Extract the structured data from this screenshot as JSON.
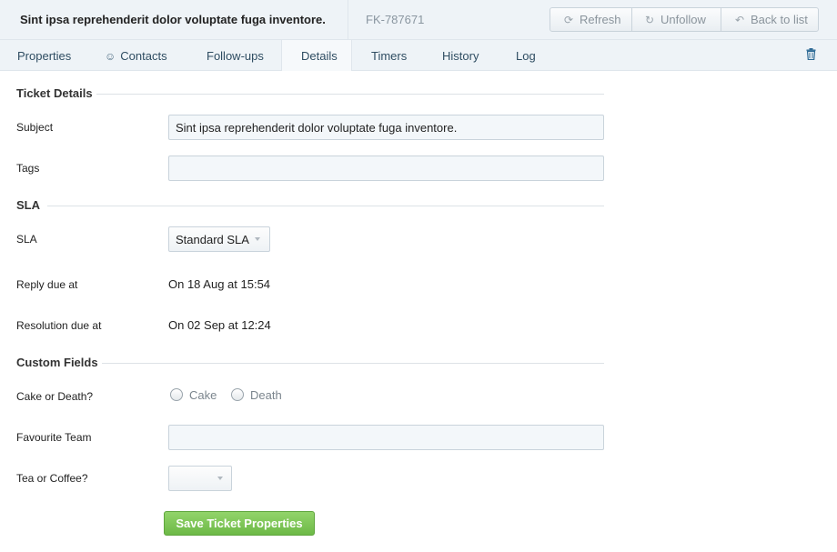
{
  "header": {
    "title": "Sint ipsa reprehenderit dolor voluptate fuga inventore.",
    "ticket_id": "FK-787671",
    "refresh_label": "Refresh",
    "unfollow_label": "Unfollow",
    "back_label": "Back to list"
  },
  "tabs": [
    {
      "label": "Properties"
    },
    {
      "label": "Contacts"
    },
    {
      "label": "Follow-ups"
    },
    {
      "label": "Details"
    },
    {
      "label": "Timers"
    },
    {
      "label": "History"
    },
    {
      "label": "Log"
    }
  ],
  "active_tab": "Details",
  "icons": {
    "refresh": "refresh-icon",
    "unfollow": "unfollow-icon",
    "back": "back-arrow-icon",
    "contacts": "contacts-icon",
    "trash": "trash-icon"
  },
  "ticket_details": {
    "heading": "Ticket Details",
    "subject_label": "Subject",
    "subject_value": "Sint ipsa reprehenderit dolor voluptate fuga inventore.",
    "tags_label": "Tags",
    "tags_value": ""
  },
  "sla": {
    "heading": "SLA",
    "sla_label": "SLA",
    "sla_value": "Standard SLA",
    "reply_due_label": "Reply due at",
    "reply_due_value": "On 18 Aug at 15:54",
    "resolution_due_label": "Resolution due at",
    "resolution_due_value": "On 02 Sep at 12:24"
  },
  "custom_fields": {
    "heading": "Custom Fields",
    "cake_or_death_label": "Cake or Death?",
    "options": [
      "Cake",
      "Death"
    ],
    "selected_option": null,
    "favourite_team_label": "Favourite Team",
    "favourite_team_value": "",
    "tea_or_coffee_label": "Tea or Coffee?",
    "tea_or_coffee_value": ""
  },
  "save_label": "Save Ticket Properties",
  "colors": {
    "header_bg": "#eef3f7",
    "tab_text": "#2f4d62",
    "save_button": "#7cc553"
  }
}
